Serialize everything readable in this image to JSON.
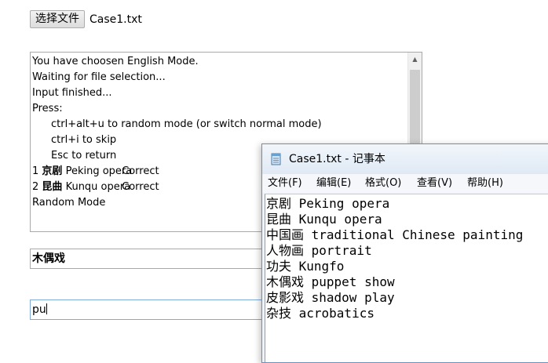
{
  "file_input": {
    "button_label": "选择文件",
    "file_name": "Case1.txt"
  },
  "log": {
    "line1": "You have choosen English Mode.",
    "line2": "Waiting for file selection...",
    "line3": "Input finished...",
    "line4": "Press:",
    "line5": "ctrl+alt+u to random mode (or switch normal mode)",
    "line6": "ctrl+i to skip",
    "line7": "Esc to return",
    "results": [
      {
        "num": "1",
        "chinese": "京剧",
        "english": "Peking opera",
        "status": "Correct"
      },
      {
        "num": "2",
        "chinese": "昆曲",
        "english": "Kunqu opera",
        "status": "Correct"
      }
    ],
    "line_last": "Random Mode"
  },
  "current_word": "木偶戏",
  "typing_input": {
    "value": "pu"
  },
  "notepad": {
    "title": "Case1.txt - 记事本",
    "menu": [
      "文件(F)",
      "编辑(E)",
      "格式(O)",
      "查看(V)",
      "帮助(H)"
    ],
    "lines": [
      "京剧 Peking opera",
      "昆曲 Kunqu opera",
      "中国画 traditional Chinese painting",
      "人物画 portrait",
      "功夫 Kungfo",
      "木偶戏 puppet show",
      "皮影戏 shadow play",
      "杂技 acrobatics"
    ]
  },
  "colors": {
    "input_focus_border": "#7ea9d8",
    "notepad_border": "#6b8fb8"
  },
  "icons": [
    "notepad-icon",
    "scroll-up-icon",
    "scroll-down-icon"
  ]
}
